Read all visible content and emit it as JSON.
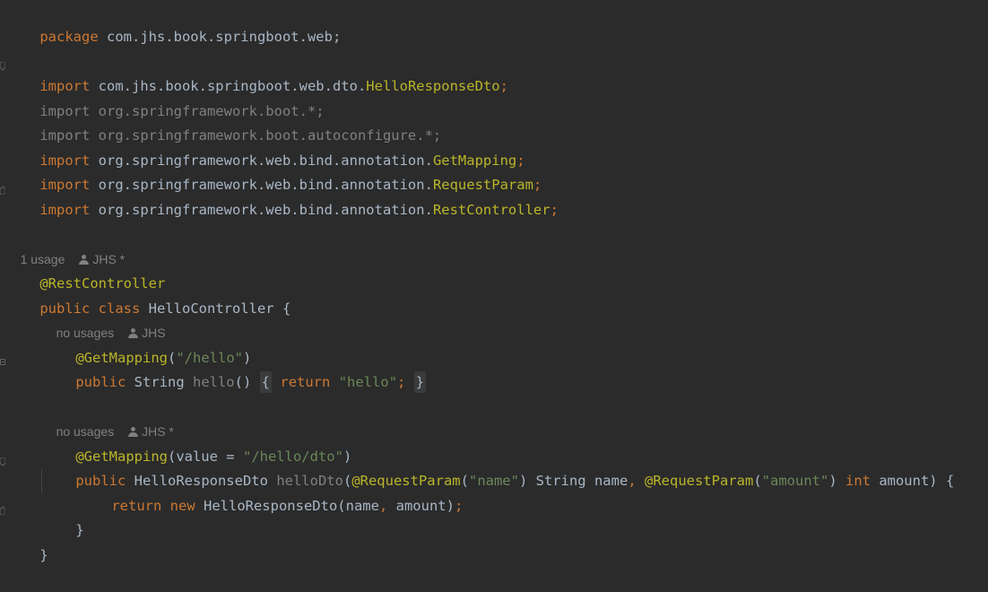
{
  "editor": {
    "package_kw": "package",
    "package_name": " com.jhs.book.springboot.web;",
    "imports": [
      {
        "kw": "import",
        "path": " com.jhs.book.springboot.web.dto.",
        "cls": "HelloResponseDto",
        "tail": ";",
        "dim": false
      },
      {
        "kw": "import",
        "path": " org.springframework.boot.*;",
        "cls": "",
        "tail": "",
        "dim": true
      },
      {
        "kw": "import",
        "path": " org.springframework.boot.autoconfigure.*;",
        "cls": "",
        "tail": "",
        "dim": true
      },
      {
        "kw": "import",
        "path": " org.springframework.web.bind.annotation.",
        "cls": "GetMapping",
        "tail": ";",
        "dim": false
      },
      {
        "kw": "import",
        "path": " org.springframework.web.bind.annotation.",
        "cls": "RequestParam",
        "tail": ";",
        "dim": false
      },
      {
        "kw": "import",
        "path": " org.springframework.web.bind.annotation.",
        "cls": "RestController",
        "tail": ";",
        "dim": false
      }
    ],
    "class_lens": {
      "usage": "1 usage",
      "author": "JHS *"
    },
    "class_annotation": "@RestController",
    "class_decl": {
      "kw1": "public",
      "kw2": " class",
      "name": " HelloController {"
    },
    "method1_lens": {
      "usage": "no usages",
      "author": "JHS"
    },
    "method1_annotation": "@GetMapping",
    "method1_annotation_open": "(",
    "method1_path": "\"/hello\"",
    "method1_annotation_close": ")",
    "method1": {
      "kw": "public",
      "type": " String ",
      "name": "hello",
      "parens": "()",
      "open": "{",
      "ret": "return",
      "value": "\"hello\"",
      "semi": ";",
      "close": "}"
    },
    "method2_lens": {
      "usage": "no usages",
      "author": "JHS *"
    },
    "method2_annotation": "@GetMapping",
    "method2_annotation_args": "(value = ",
    "method2_path": "\"/hello/dto\"",
    "method2_annotation_close": ")",
    "method2": {
      "kw": "public",
      "type": " HelloResponseDto ",
      "name": "helloDto",
      "p_open": "(",
      "ann1": "@RequestParam",
      "ann1_open": "(",
      "ann1_val": "\"name\"",
      "ann1_rest": ") String name",
      "comma": ",",
      "ann2": " @RequestParam",
      "ann2_open": "(",
      "ann2_val": "\"amount\"",
      "ann2_close": ") ",
      "int_kw": "int",
      "tail": " amount) {"
    },
    "return_line": {
      "kw": "return",
      "kw2": " new",
      "rest": " HelloResponseDto(name",
      "comma": ",",
      "rest2": " amount)",
      "semi": ";"
    },
    "method2_close": "}",
    "class_close": "}"
  }
}
